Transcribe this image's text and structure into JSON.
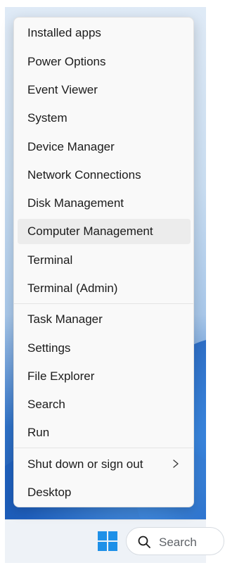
{
  "menu": {
    "items": [
      {
        "label": "Installed apps"
      },
      {
        "label": "Power Options"
      },
      {
        "label": "Event Viewer"
      },
      {
        "label": "System"
      },
      {
        "label": "Device Manager"
      },
      {
        "label": "Network Connections"
      },
      {
        "label": "Disk Management"
      },
      {
        "label": "Computer Management"
      },
      {
        "label": "Terminal"
      },
      {
        "label": "Terminal (Admin)"
      },
      {
        "label": "Task Manager"
      },
      {
        "label": "Settings"
      },
      {
        "label": "File Explorer"
      },
      {
        "label": "Search"
      },
      {
        "label": "Run"
      },
      {
        "label": "Shut down or sign out",
        "submenu_icon": "chevron-right-icon"
      },
      {
        "label": "Desktop"
      }
    ],
    "highlighted_item": "Computer Management"
  },
  "taskbar": {
    "start_icon": "windows-logo-icon",
    "search_icon": "search-icon",
    "search_label": "Search"
  },
  "colors": {
    "menu_background": "#f9f9f9",
    "hover_background": "#ececec",
    "windows_blue": "#1e90e8"
  }
}
